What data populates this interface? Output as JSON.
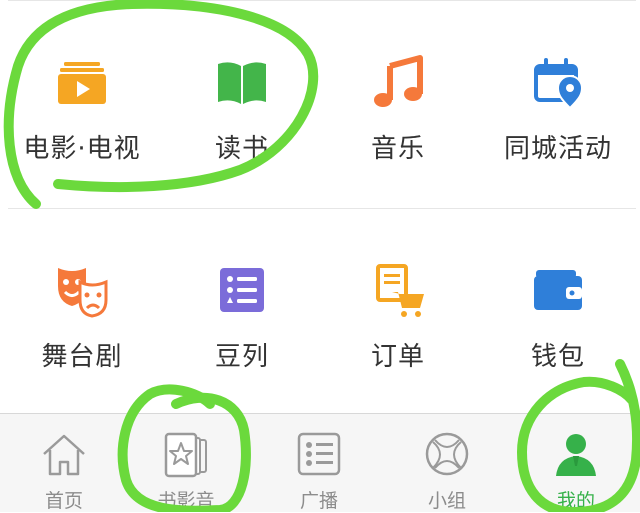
{
  "grid": {
    "items": [
      {
        "label": "电影·电视",
        "icon": "movie-tv-icon"
      },
      {
        "label": "读书",
        "icon": "book-icon"
      },
      {
        "label": "音乐",
        "icon": "music-note-icon"
      },
      {
        "label": "同城活动",
        "icon": "calendar-location-icon"
      },
      {
        "label": "舞台剧",
        "icon": "theater-masks-icon"
      },
      {
        "label": "豆列",
        "icon": "list-icon"
      },
      {
        "label": "订单",
        "icon": "order-cart-icon"
      },
      {
        "label": "钱包",
        "icon": "wallet-icon"
      }
    ]
  },
  "tabbar": {
    "tabs": [
      {
        "label": "首页",
        "icon": "home-icon"
      },
      {
        "label": "书影音",
        "icon": "star-cards-icon"
      },
      {
        "label": "广播",
        "icon": "list-card-icon"
      },
      {
        "label": "小组",
        "icon": "globe-icon"
      },
      {
        "label": "我的",
        "icon": "person-icon",
        "active": true
      }
    ]
  },
  "colors": {
    "orange": "#F5A623",
    "green": "#43B54A",
    "music": "#F5793B",
    "blue": "#2F7FD9",
    "purple": "#7B6CD9",
    "accent": "#36B14A",
    "annotation": "#6BD93C"
  }
}
